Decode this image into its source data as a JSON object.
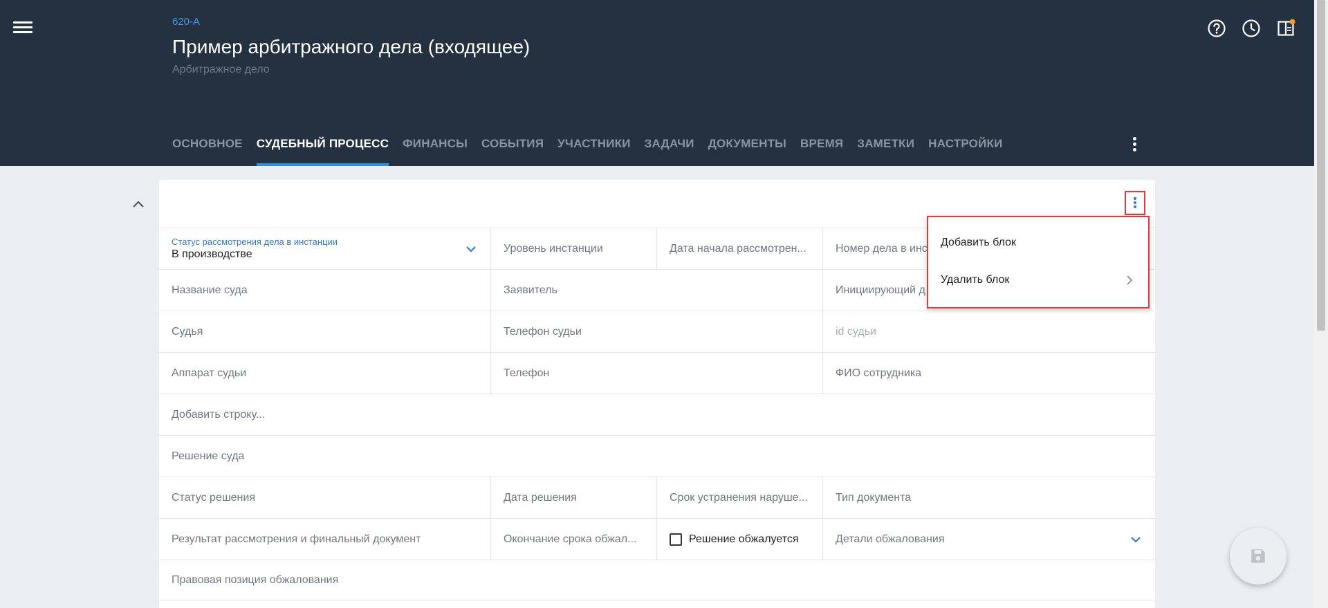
{
  "header": {
    "case_code": "620-А",
    "title": "Пример арбитражного дела (входящее)",
    "subtitle": "Арбитражное дело",
    "icons": [
      "menu-icon",
      "help-icon",
      "history-icon",
      "panel-icon"
    ],
    "notification_dot_color": "#f59a23"
  },
  "tabs": [
    {
      "label": "ОСНОВНОЕ",
      "active": false
    },
    {
      "label": "СУДЕБНЫЙ ПРОЦЕСС",
      "active": true
    },
    {
      "label": "ФИНАНСЫ",
      "active": false
    },
    {
      "label": "СОБЫТИЯ",
      "active": false
    },
    {
      "label": "УЧАСТНИКИ",
      "active": false
    },
    {
      "label": "ЗАДАЧИ",
      "active": false
    },
    {
      "label": "ДОКУМЕНТЫ",
      "active": false
    },
    {
      "label": "ВРЕМЯ",
      "active": false
    },
    {
      "label": "ЗАМЕТКИ",
      "active": false
    },
    {
      "label": "НАСТРОЙКИ",
      "active": false
    }
  ],
  "form": {
    "status": {
      "label": "Статус рассмотрения дела в инстанции",
      "value": "В производстве"
    },
    "instance_level": "Уровень инстанции",
    "start_date": "Дата начала рассмотрен...",
    "case_number": "Номер дела в инс",
    "court_name": "Название суда",
    "applicant": "Заявитель",
    "initiating": "Инициирующий д",
    "judge": "Судья",
    "judge_phone": "Телефон судьи",
    "judge_id": "id судьи",
    "judge_staff": "Аппарат судьи",
    "phone": "Телефон",
    "employee_name": "ФИО сотрудника",
    "add_row": "Добавить строку...",
    "court_decision": "Решение суда",
    "decision_status": "Статус решения",
    "decision_date": "Дата решения",
    "violation_deadline": "Срок устранения наруше...",
    "document_type": "Тип документа",
    "result": "Результат рассмотрения и финальный документ",
    "appeal_end": "Окончание срока обжал...",
    "appealed_checkbox": {
      "label": "Решение обжалуется",
      "checked": false
    },
    "appeal_details": "Детали обжалования",
    "appeal_position": "Правовая позиция обжалования"
  },
  "dropdown": {
    "items": [
      "Добавить блок",
      "Удалить блок"
    ]
  },
  "colors": {
    "header_bg": "#233140",
    "accent": "#2d8fe0",
    "highlight_border": "#e53935"
  }
}
